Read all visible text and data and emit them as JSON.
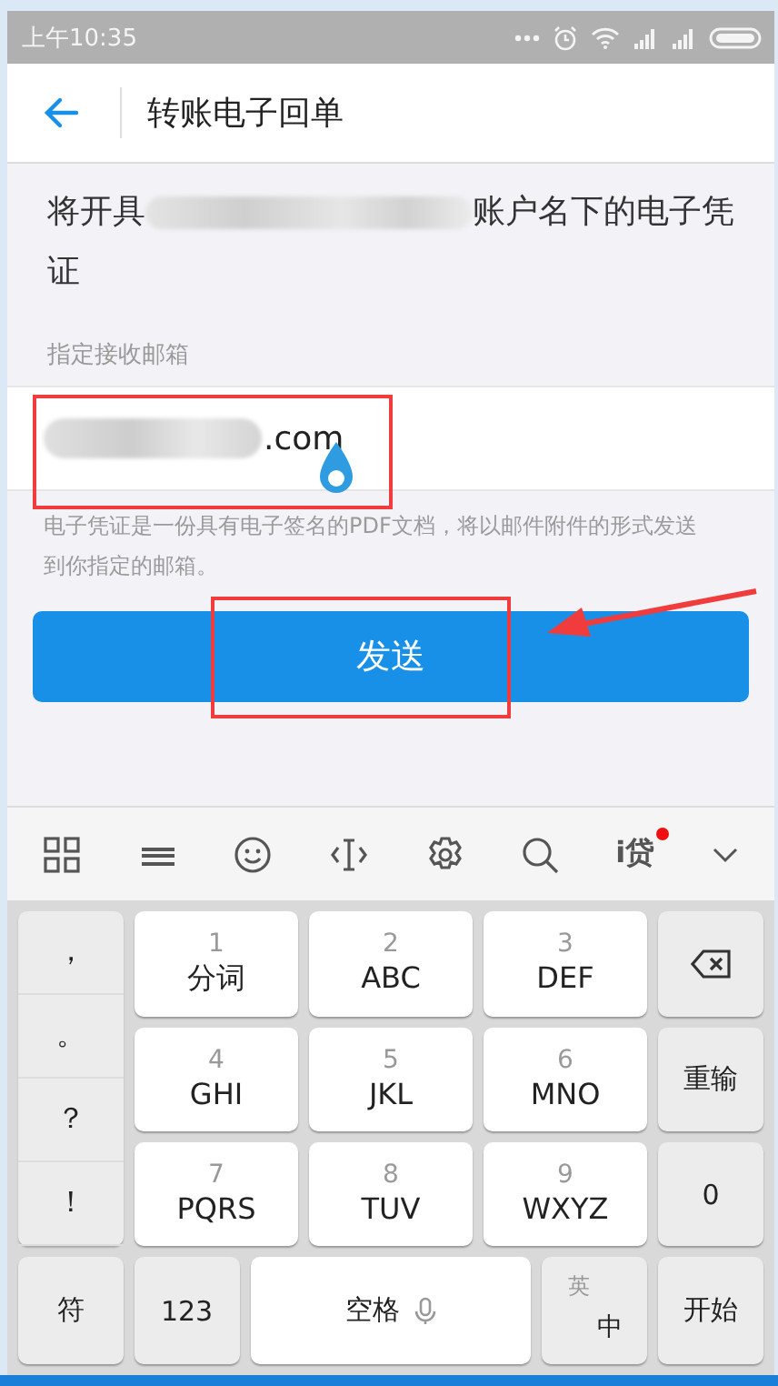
{
  "status_bar": {
    "time": "上午10:35"
  },
  "header": {
    "title": "转账电子回单"
  },
  "notice": {
    "prefix": "将开具",
    "suffix": "账户名下的电子凭证"
  },
  "email": {
    "label": "指定接收邮箱",
    "value": ".com"
  },
  "hint": "电子凭证是一份具有电子签名的PDF文档，将以邮件附件的形式发送到你指定的邮箱。",
  "send_button": "发送",
  "keyboard": {
    "toolbar": {
      "loan_label": "i贷",
      "loan_badge": true
    },
    "symbols": [
      "，",
      "。",
      "？",
      "！"
    ],
    "digit_keys": [
      {
        "digit": "1",
        "letters": "分词"
      },
      {
        "digit": "2",
        "letters": "ABC"
      },
      {
        "digit": "3",
        "letters": "DEF"
      },
      {
        "digit": "4",
        "letters": "GHI"
      },
      {
        "digit": "5",
        "letters": "JKL"
      },
      {
        "digit": "6",
        "letters": "MNO"
      },
      {
        "digit": "7",
        "letters": "PQRS"
      },
      {
        "digit": "8",
        "letters": "TUV"
      },
      {
        "digit": "9",
        "letters": "WXYZ"
      }
    ],
    "side_keys": [
      {
        "kind": "backspace"
      },
      {
        "kind": "text",
        "label": "重输"
      },
      {
        "kind": "text",
        "label": "0"
      }
    ],
    "bottom_keys": [
      {
        "kind": "func",
        "label": "符"
      },
      {
        "kind": "func",
        "label": "123"
      },
      {
        "kind": "space",
        "label": "空格"
      },
      {
        "kind": "lang",
        "top": "英",
        "bottom": "中"
      },
      {
        "kind": "func",
        "label": "开始"
      }
    ]
  }
}
